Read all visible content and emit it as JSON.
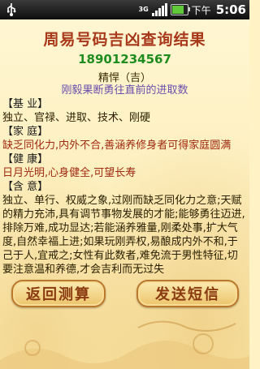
{
  "status_bar": {
    "network": "3G",
    "label": "下午",
    "time": "5:06"
  },
  "screen": {
    "title": "周易号码吉凶查询结果",
    "number": "18901234567",
    "rating": "精悍（吉）",
    "tagline": "刚毅果断勇往直前的进取数"
  },
  "sections": [
    {
      "heading": "【基 业】",
      "text": "独立、官禄、进取、技术、刚硬",
      "tone": "normal"
    },
    {
      "heading": "【家 庭】",
      "text": "缺乏同化力,内外不合,善涵养修身者可得家庭圆满",
      "tone": "red"
    },
    {
      "heading": "【健 康】",
      "text": "日月光明,心身健全,可望长寿",
      "tone": "red"
    },
    {
      "heading": "【含 意】",
      "text": "独立、单行、权威之象,过刚而缺乏同化力之意;天赋的精力充沛,具有调节事物发展的才能;能够勇往迈进,排除万难,成功显达;若能涵养雅量,刚柔处事,扩大气度,自然幸福上进;如果玩刚弄权,易酿成内外不和,于己于人,宜戒之;女性有此数者,难免流于男性特征,切要注意温和养德,才会吉利而无过失",
      "tone": "normal"
    }
  ],
  "buttons": {
    "back": "返回测算",
    "send": "发送短信"
  },
  "icons": [
    "usb-icon",
    "signal-icon",
    "battery-icon"
  ],
  "colors": {
    "title": "#a8381a",
    "number": "#1f8c1f",
    "tagline": "#6a4fae",
    "accent_red": "#a02a12"
  }
}
